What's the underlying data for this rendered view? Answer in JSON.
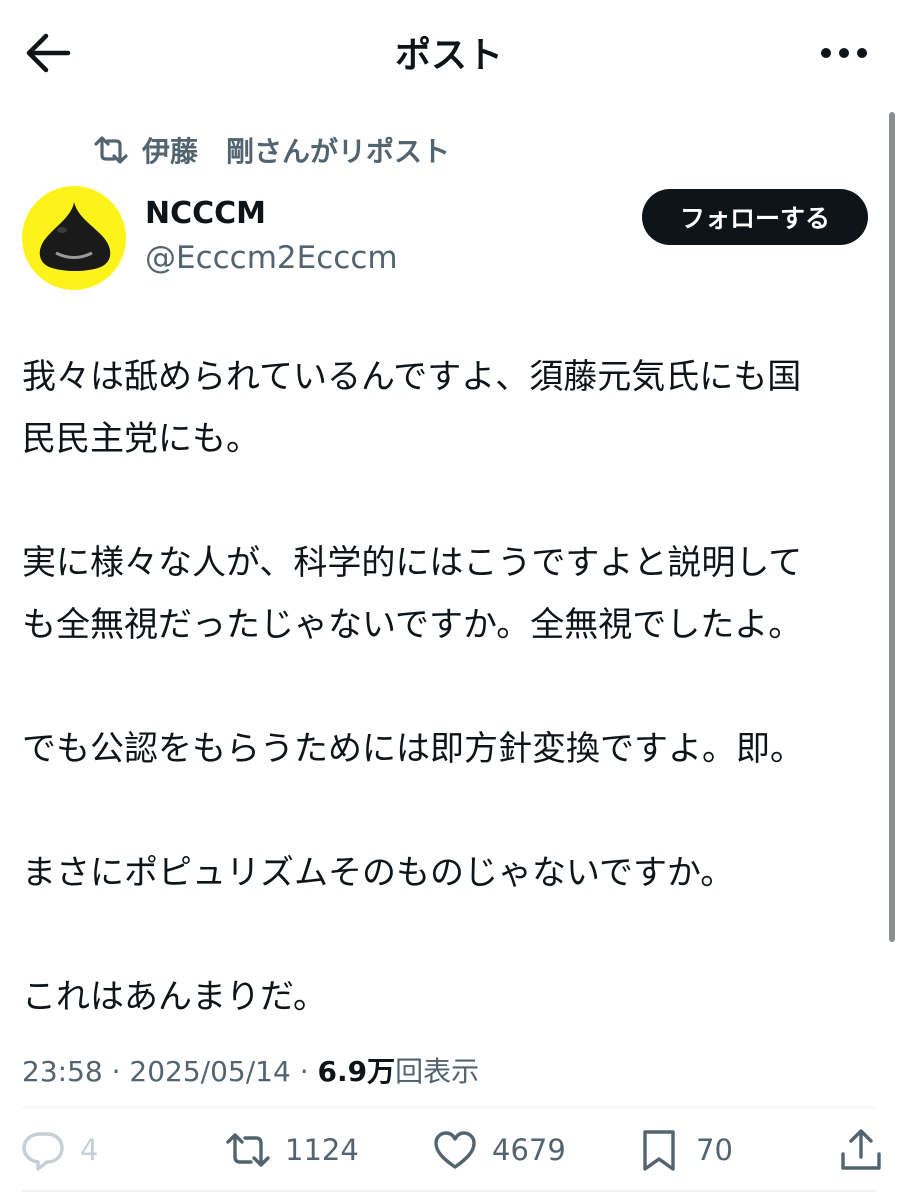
{
  "header": {
    "title": "ポスト"
  },
  "repost": {
    "text": "伊藤　剛さんがリポスト"
  },
  "author": {
    "name": "NCCCM",
    "handle": "@Ecccm2Ecccm"
  },
  "follow_label": "フォローする",
  "post": {
    "paragraphs": [
      "我々は舐められているんですよ、須藤元気氏にも国\n民民主党にも。",
      "実に様々な人が、科学的にはこうですよと説明して\nも全無視だったじゃないですか。全無視でしたよ。",
      "でも公認をもらうためには即方針変換ですよ。即。",
      "まさにポピュリズムそのものじゃないですか。",
      "これはあんまりだ。"
    ]
  },
  "meta": {
    "time": "23:58",
    "sep": " · ",
    "date": "2025/05/14",
    "views": "6.9万",
    "views_label": "回表示"
  },
  "stats": {
    "replies": "4",
    "reposts": "1124",
    "likes": "4679",
    "bookmarks": "70"
  },
  "colors": {
    "accent": "#0f1419",
    "secondary": "#536471",
    "avatar_bg": "#fdf31b"
  }
}
